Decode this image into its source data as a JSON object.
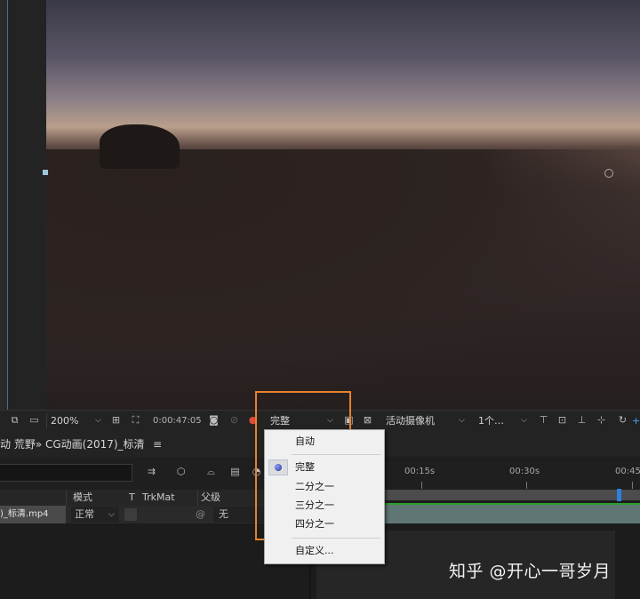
{
  "viewer_toolbar": {
    "zoom": "200%",
    "timecode": "0:00:47:05",
    "resolution": "完整",
    "camera": "活动摄像机",
    "views": "1个…",
    "plus": "+"
  },
  "timeline": {
    "tab_title": "动 荒野» CG动画(2017)_标清",
    "menu_icon": "≡",
    "columns": {
      "mode": "模式",
      "t": "T",
      "trkmat": "TrkMat",
      "parent": "父级"
    },
    "layer": {
      "name": ")_标清.mp4",
      "mode": "正常",
      "parent": "无"
    },
    "ruler_labels": [
      "00:15s",
      "00:30s",
      "00:45"
    ]
  },
  "resolution_menu": {
    "items": [
      "自动",
      "完整",
      "二分之一",
      "三分之一",
      "四分之一",
      "自定义..."
    ],
    "selected": "完整"
  },
  "watermark": "知乎 @开心一哥岁月",
  "colors": {
    "highlight_box": "#e8812a",
    "track_green": "#2ca02c",
    "playhead_blue": "#2f7fe0"
  }
}
